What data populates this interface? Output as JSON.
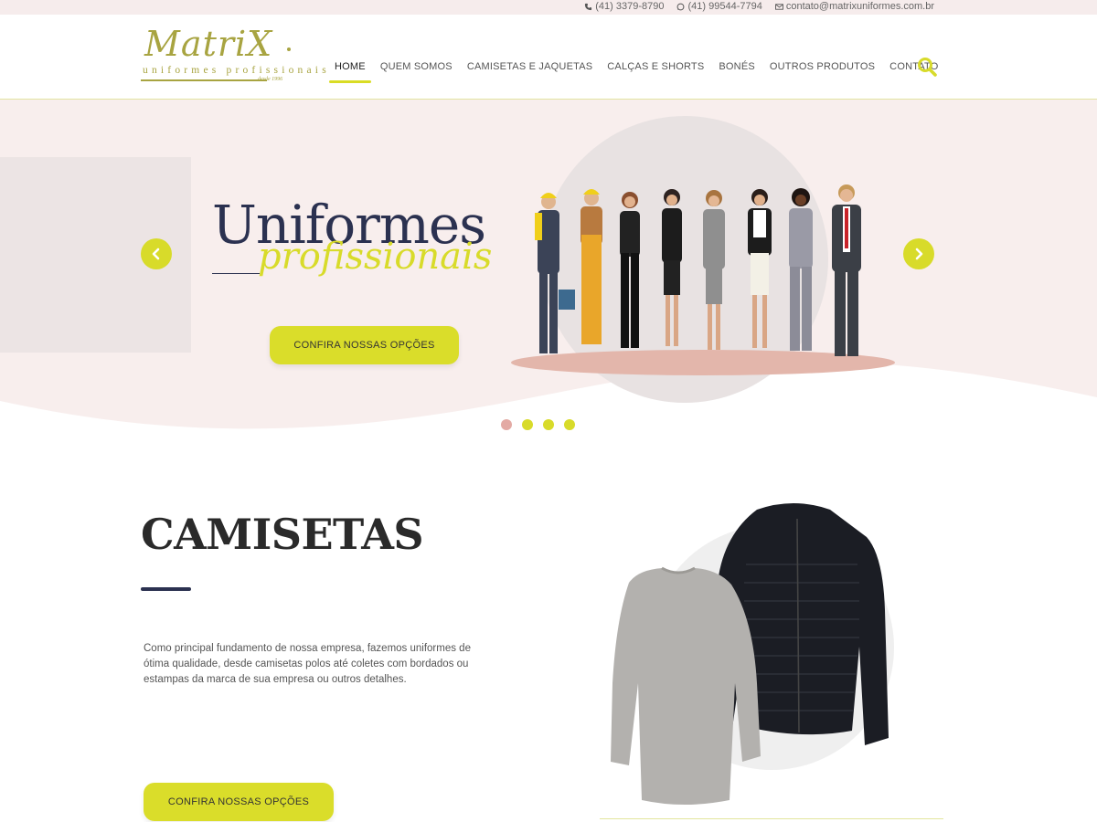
{
  "topbar": {
    "phone": "(41) 3379-8790",
    "whatsapp": "(41) 99544-7794",
    "email": "contato@matrixuniformes.com.br"
  },
  "logo": {
    "name": "MatriX",
    "tagline": "uniformes profissionais",
    "since": "desde 1996"
  },
  "nav": {
    "items": [
      {
        "label": "HOME"
      },
      {
        "label": "QUEM SOMOS"
      },
      {
        "label": "CAMISETAS E JAQUETAS"
      },
      {
        "label": "CALÇAS E SHORTS"
      },
      {
        "label": "BONÉS"
      },
      {
        "label": "OUTROS PRODUTOS"
      },
      {
        "label": "CONTATO"
      }
    ],
    "active": "HOME",
    "search_icon": "search-icon"
  },
  "hero": {
    "title": "Uniformes",
    "subtitle": "profissionais",
    "cta_label": "CONFIRA NOSSAS OPÇÕES",
    "slide_count": 4,
    "active_slide": 1
  },
  "section": {
    "title": "CAMISETAS",
    "text": "Como principal fundamento de nossa empresa, fazemos uniformes de ótima qualidade, desde camisetas polos até coletes com bordados ou estampas da marca de sua empresa ou outros detalhes.",
    "cta_label": "CONFIRA NOSSAS OPÇÕES"
  },
  "colors": {
    "accent": "#d8db2a",
    "navy": "#2b3150",
    "hero_bg": "#f8eeed",
    "olive": "#a8a441",
    "dot_active": "#e3aaa4"
  }
}
